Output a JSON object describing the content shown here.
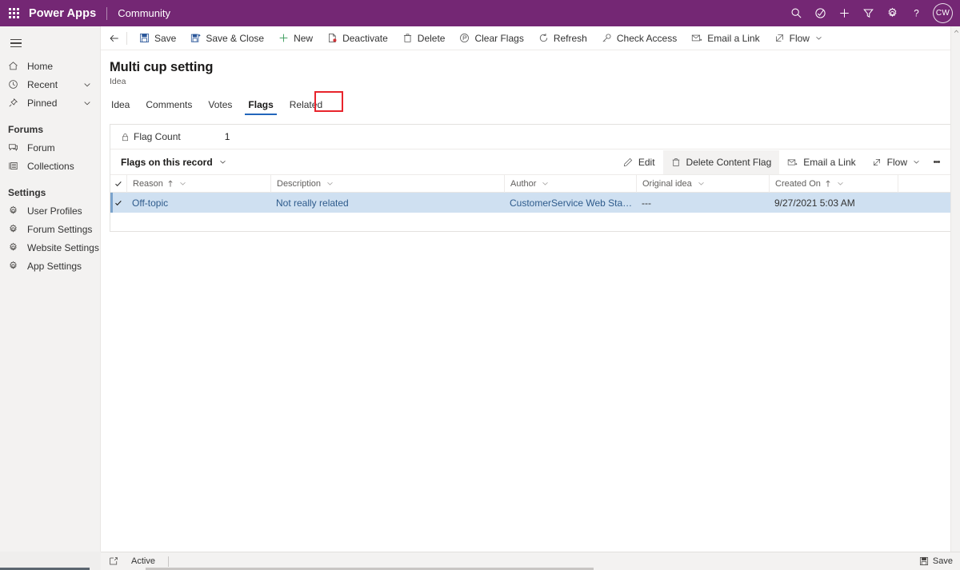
{
  "topbar": {
    "waffle_label": "App launcher",
    "brand": "Power Apps",
    "app_name": "Community",
    "icons": [
      {
        "name": "search-icon",
        "label": "Search"
      },
      {
        "name": "check-circle-icon",
        "label": "Assistant"
      },
      {
        "name": "plus-icon",
        "label": "New"
      },
      {
        "name": "filter-icon",
        "label": "Filter"
      },
      {
        "name": "gear-icon",
        "label": "Settings"
      },
      {
        "name": "help-icon",
        "label": "Help"
      }
    ],
    "avatar_initials": "CW",
    "accent_color": "#742774"
  },
  "sidebar": {
    "hamburger_label": "Site map",
    "items": [
      {
        "label": "Home",
        "icon": "home-icon",
        "chevron": false
      },
      {
        "label": "Recent",
        "icon": "clock-icon",
        "chevron": true
      },
      {
        "label": "Pinned",
        "icon": "pin-icon",
        "chevron": true
      }
    ],
    "groups": [
      {
        "title": "Forums",
        "items": [
          {
            "label": "Forum",
            "icon": "forum-icon"
          },
          {
            "label": "Collections",
            "icon": "collections-icon"
          }
        ]
      },
      {
        "title": "Settings",
        "items": [
          {
            "label": "User Profiles",
            "icon": "gear-icon"
          },
          {
            "label": "Forum Settings",
            "icon": "gear-icon"
          },
          {
            "label": "Website Settings",
            "icon": "gear-icon"
          },
          {
            "label": "App Settings",
            "icon": "gear-icon"
          }
        ]
      }
    ]
  },
  "commandbar": {
    "back_label": "Back",
    "buttons": [
      {
        "label": "Save",
        "icon": "save-icon"
      },
      {
        "label": "Save & Close",
        "icon": "save-close-icon"
      },
      {
        "label": "New",
        "icon": "plus-icon"
      },
      {
        "label": "Deactivate",
        "icon": "deactivate-icon"
      },
      {
        "label": "Delete",
        "icon": "trash-icon"
      },
      {
        "label": "Clear Flags",
        "icon": "clear-flags-icon"
      },
      {
        "label": "Refresh",
        "icon": "refresh-icon"
      },
      {
        "label": "Check Access",
        "icon": "key-icon"
      },
      {
        "label": "Email a Link",
        "icon": "email-link-icon"
      },
      {
        "label": "Flow",
        "icon": "flow-icon",
        "caret": true
      }
    ]
  },
  "page": {
    "title": "Multi cup setting",
    "subtitle": "Idea",
    "tabs": [
      {
        "label": "Idea",
        "active": false
      },
      {
        "label": "Comments",
        "active": false
      },
      {
        "label": "Votes",
        "active": false
      },
      {
        "label": "Flags",
        "active": true,
        "highlighted": true
      },
      {
        "label": "Related",
        "active": false
      }
    ],
    "highlight_color": "#e8242c",
    "active_tab_color": "#2266bb"
  },
  "flag_count": {
    "label": "Flag Count",
    "icon": "lock-icon",
    "value": "1"
  },
  "subgrid": {
    "title": "Flags on this record",
    "actions": [
      {
        "label": "Edit",
        "icon": "pencil-icon",
        "selected": false
      },
      {
        "label": "Delete Content Flag",
        "icon": "trash-icon",
        "selected": true
      },
      {
        "label": "Email a Link",
        "icon": "email-link-icon",
        "selected": false
      },
      {
        "label": "Flow",
        "icon": "flow-icon",
        "caret": true,
        "selected": false
      }
    ],
    "overflow_label": "More commands",
    "columns": [
      {
        "label": "Reason",
        "sort": "asc",
        "caret": true
      },
      {
        "label": "Description",
        "sort": null,
        "caret": true
      },
      {
        "label": "Author",
        "sort": null,
        "caret": true
      },
      {
        "label": "Original idea",
        "sort": null,
        "caret": true
      },
      {
        "label": "Created On",
        "sort": "asc",
        "caret": true
      }
    ],
    "rows": [
      {
        "selected": true,
        "reason": "Off-topic",
        "description": "Not really related",
        "author": "CustomerService Web Staging",
        "original_idea": "---",
        "created_on": "9/27/2021 5:03 AM"
      }
    ],
    "selected_row_color": "#cfe0f1"
  },
  "statusbar": {
    "state_icon": "open-record-icon",
    "state": "Active",
    "save_label": "Save",
    "save_icon": "save-icon"
  },
  "scrollbar": {
    "up_arrow_label": "Scroll up"
  }
}
